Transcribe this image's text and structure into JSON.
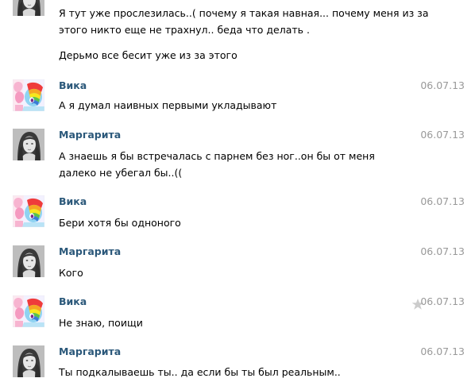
{
  "messages": [
    {
      "author": "",
      "date": "",
      "avatar_icon": "girl-photo-avatar",
      "paragraphs": [
        "Я тут уже прослезилась..( почему я такая навная... почему меня из за этого никто еще не трахнул.. беда что делать .",
        "Дерьмо все бесит уже из за этого"
      ]
    },
    {
      "author": "Вика",
      "date": "06.07.13",
      "avatar_icon": "pony-cartoon-avatar",
      "paragraphs": [
        "А я думал наивных первыми укладывают"
      ]
    },
    {
      "author": "Маргарита",
      "date": "06.07.13",
      "avatar_icon": "girl-photo-avatar",
      "paragraphs": [
        "А знаешь я бы встречалась с парнем без ног..он бы от меня далеко не убегал бы..(("
      ]
    },
    {
      "author": "Вика",
      "date": "06.07.13",
      "avatar_icon": "pony-cartoon-avatar",
      "paragraphs": [
        "Бери хотя бы одноного"
      ]
    },
    {
      "author": "Маргарита",
      "date": "06.07.13",
      "avatar_icon": "girl-photo-avatar",
      "paragraphs": [
        "Кого"
      ]
    },
    {
      "author": "Вика",
      "date": "06.07.13",
      "avatar_icon": "pony-cartoon-avatar",
      "favorite_icon": "star-icon",
      "paragraphs": [
        "Не знаю, поищи"
      ]
    },
    {
      "author": "Маргарита",
      "date": "06.07.13",
      "avatar_icon": "girl-photo-avatar",
      "paragraphs": [
        "Ты подкалываешь ты.. да если бы ты был реальным.."
      ]
    }
  ],
  "colors": {
    "author_link": "#2b587a",
    "date": "#999999",
    "star": "#cccccc"
  }
}
